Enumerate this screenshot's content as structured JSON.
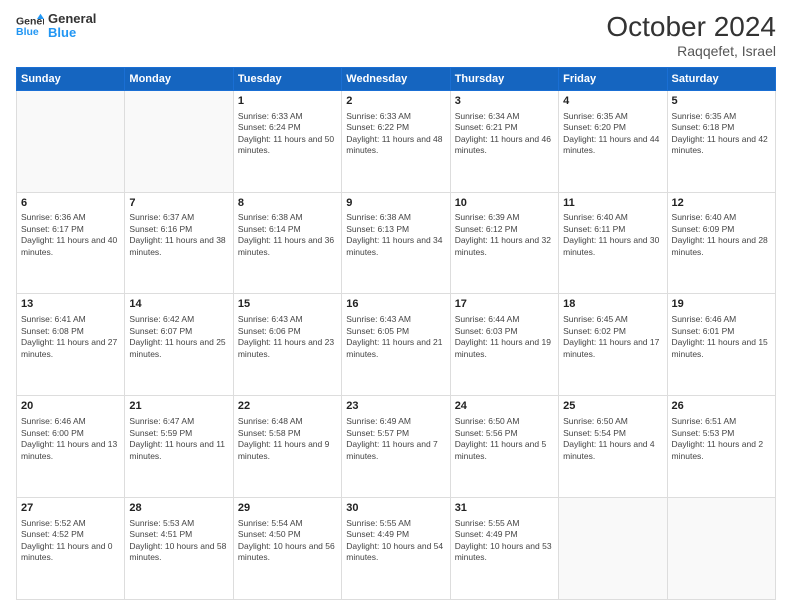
{
  "header": {
    "logo_line1": "General",
    "logo_line2": "Blue",
    "month": "October 2024",
    "location": "Raqqefet, Israel"
  },
  "days_of_week": [
    "Sunday",
    "Monday",
    "Tuesday",
    "Wednesday",
    "Thursday",
    "Friday",
    "Saturday"
  ],
  "weeks": [
    [
      {
        "day": "",
        "info": ""
      },
      {
        "day": "",
        "info": ""
      },
      {
        "day": "1",
        "info": "Sunrise: 6:33 AM\nSunset: 6:24 PM\nDaylight: 11 hours and 50 minutes."
      },
      {
        "day": "2",
        "info": "Sunrise: 6:33 AM\nSunset: 6:22 PM\nDaylight: 11 hours and 48 minutes."
      },
      {
        "day": "3",
        "info": "Sunrise: 6:34 AM\nSunset: 6:21 PM\nDaylight: 11 hours and 46 minutes."
      },
      {
        "day": "4",
        "info": "Sunrise: 6:35 AM\nSunset: 6:20 PM\nDaylight: 11 hours and 44 minutes."
      },
      {
        "day": "5",
        "info": "Sunrise: 6:35 AM\nSunset: 6:18 PM\nDaylight: 11 hours and 42 minutes."
      }
    ],
    [
      {
        "day": "6",
        "info": "Sunrise: 6:36 AM\nSunset: 6:17 PM\nDaylight: 11 hours and 40 minutes."
      },
      {
        "day": "7",
        "info": "Sunrise: 6:37 AM\nSunset: 6:16 PM\nDaylight: 11 hours and 38 minutes."
      },
      {
        "day": "8",
        "info": "Sunrise: 6:38 AM\nSunset: 6:14 PM\nDaylight: 11 hours and 36 minutes."
      },
      {
        "day": "9",
        "info": "Sunrise: 6:38 AM\nSunset: 6:13 PM\nDaylight: 11 hours and 34 minutes."
      },
      {
        "day": "10",
        "info": "Sunrise: 6:39 AM\nSunset: 6:12 PM\nDaylight: 11 hours and 32 minutes."
      },
      {
        "day": "11",
        "info": "Sunrise: 6:40 AM\nSunset: 6:11 PM\nDaylight: 11 hours and 30 minutes."
      },
      {
        "day": "12",
        "info": "Sunrise: 6:40 AM\nSunset: 6:09 PM\nDaylight: 11 hours and 28 minutes."
      }
    ],
    [
      {
        "day": "13",
        "info": "Sunrise: 6:41 AM\nSunset: 6:08 PM\nDaylight: 11 hours and 27 minutes."
      },
      {
        "day": "14",
        "info": "Sunrise: 6:42 AM\nSunset: 6:07 PM\nDaylight: 11 hours and 25 minutes."
      },
      {
        "day": "15",
        "info": "Sunrise: 6:43 AM\nSunset: 6:06 PM\nDaylight: 11 hours and 23 minutes."
      },
      {
        "day": "16",
        "info": "Sunrise: 6:43 AM\nSunset: 6:05 PM\nDaylight: 11 hours and 21 minutes."
      },
      {
        "day": "17",
        "info": "Sunrise: 6:44 AM\nSunset: 6:03 PM\nDaylight: 11 hours and 19 minutes."
      },
      {
        "day": "18",
        "info": "Sunrise: 6:45 AM\nSunset: 6:02 PM\nDaylight: 11 hours and 17 minutes."
      },
      {
        "day": "19",
        "info": "Sunrise: 6:46 AM\nSunset: 6:01 PM\nDaylight: 11 hours and 15 minutes."
      }
    ],
    [
      {
        "day": "20",
        "info": "Sunrise: 6:46 AM\nSunset: 6:00 PM\nDaylight: 11 hours and 13 minutes."
      },
      {
        "day": "21",
        "info": "Sunrise: 6:47 AM\nSunset: 5:59 PM\nDaylight: 11 hours and 11 minutes."
      },
      {
        "day": "22",
        "info": "Sunrise: 6:48 AM\nSunset: 5:58 PM\nDaylight: 11 hours and 9 minutes."
      },
      {
        "day": "23",
        "info": "Sunrise: 6:49 AM\nSunset: 5:57 PM\nDaylight: 11 hours and 7 minutes."
      },
      {
        "day": "24",
        "info": "Sunrise: 6:50 AM\nSunset: 5:56 PM\nDaylight: 11 hours and 5 minutes."
      },
      {
        "day": "25",
        "info": "Sunrise: 6:50 AM\nSunset: 5:54 PM\nDaylight: 11 hours and 4 minutes."
      },
      {
        "day": "26",
        "info": "Sunrise: 6:51 AM\nSunset: 5:53 PM\nDaylight: 11 hours and 2 minutes."
      }
    ],
    [
      {
        "day": "27",
        "info": "Sunrise: 5:52 AM\nSunset: 4:52 PM\nDaylight: 11 hours and 0 minutes."
      },
      {
        "day": "28",
        "info": "Sunrise: 5:53 AM\nSunset: 4:51 PM\nDaylight: 10 hours and 58 minutes."
      },
      {
        "day": "29",
        "info": "Sunrise: 5:54 AM\nSunset: 4:50 PM\nDaylight: 10 hours and 56 minutes."
      },
      {
        "day": "30",
        "info": "Sunrise: 5:55 AM\nSunset: 4:49 PM\nDaylight: 10 hours and 54 minutes."
      },
      {
        "day": "31",
        "info": "Sunrise: 5:55 AM\nSunset: 4:49 PM\nDaylight: 10 hours and 53 minutes."
      },
      {
        "day": "",
        "info": ""
      },
      {
        "day": "",
        "info": ""
      }
    ]
  ]
}
